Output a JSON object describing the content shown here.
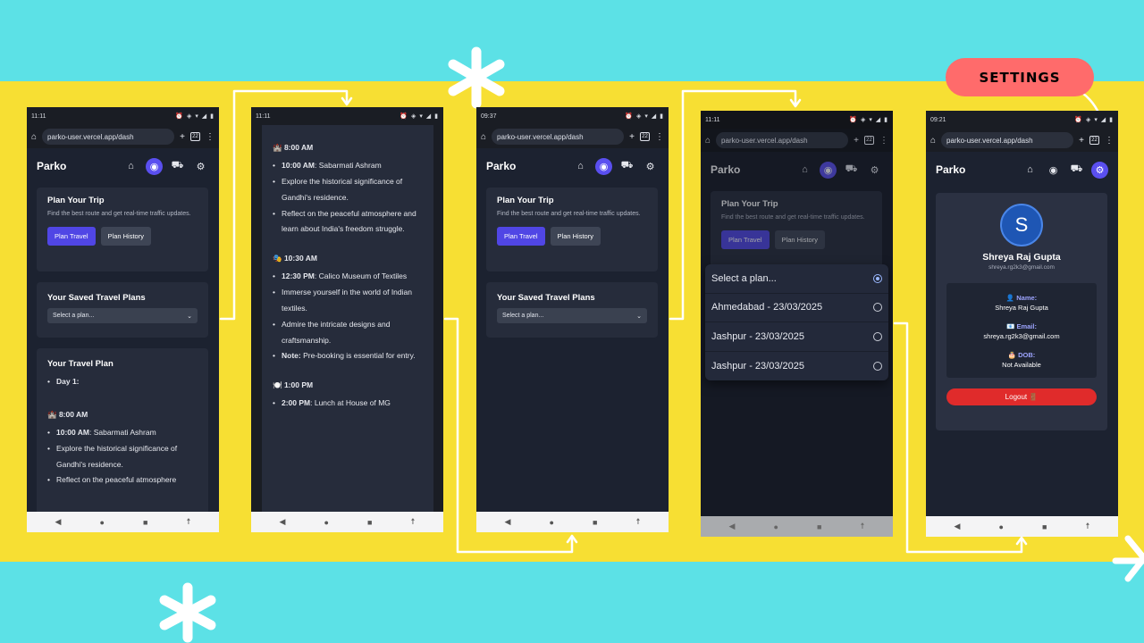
{
  "callout": {
    "label": "SETTINGS"
  },
  "app": {
    "brand": "Parko",
    "url": "parko-user.vercel.app/dash",
    "tab_count": "22"
  },
  "phone1": {
    "time": "11:11",
    "plan_card": {
      "title": "Plan Your Trip",
      "desc": "Find the best route and get real-time traffic updates.",
      "btn_travel": "Plan Travel",
      "btn_history": "Plan History"
    },
    "saved": {
      "title": "Your Saved Travel Plans",
      "select": "Select a plan..."
    },
    "travel": {
      "title": "Your Travel Plan",
      "day": "Day 1:",
      "t1": "🏰 8:00 AM",
      "i1_time": "10:00 AM",
      "i1_text": ": Sabarmati Ashram",
      "i2": "Explore the historical significance of Gandhi's residence.",
      "i3": "Reflect on the peaceful atmosphere"
    }
  },
  "phone2": {
    "time": "11:11",
    "t1": "🏰 8:00 AM",
    "a1_time": "10:00 AM",
    "a1_text": ": Sabarmati Ashram",
    "a2": "Explore the historical significance of Gandhi's residence.",
    "a3": "Reflect on the peaceful atmosphere and learn about India's freedom struggle.",
    "t2": "🎭 10:30 AM",
    "b1_time": "12:30 PM",
    "b1_text": ": Calico Museum of Textiles",
    "b2": "Immerse yourself in the world of Indian textiles.",
    "b3": "Admire the intricate designs and craftsmanship.",
    "b4_bold": "Note:",
    "b4_text": " Pre-booking is essential for entry.",
    "t3": "🍽️ 1:00 PM",
    "c1_time": "2:00 PM",
    "c1_text": ": Lunch at House of MG"
  },
  "phone3": {
    "time": "09:37",
    "plan_card": {
      "title": "Plan Your Trip",
      "desc": "Find the best route and get real-time traffic updates.",
      "btn_travel": "Plan Travel",
      "btn_history": "Plan History"
    },
    "saved": {
      "title": "Your Saved Travel Plans",
      "select": "Select a plan..."
    }
  },
  "phone4": {
    "time": "11:11",
    "plan_card": {
      "title": "Plan Your Trip",
      "desc": "Find the best route and get real-time traffic updates.",
      "btn_travel": "Plan Travel",
      "btn_history": "Plan History"
    },
    "options": [
      "Select a plan...",
      "Ahmedabad - 23/03/2025",
      "Jashpur - 23/03/2025",
      "Jashpur - 23/03/2025"
    ]
  },
  "phone5": {
    "time": "09:21",
    "avatar_letter": "S",
    "name": "Shreya Raj Gupta",
    "email_small": "shreya.rg2k3@gmail.com",
    "name_label": "👤 Name:",
    "name_value": "Shreya Raj Gupta",
    "email_label": "📧 Email:",
    "email_value": "shreya.rg2k3@gmail.com",
    "dob_label": "🎂 DOB:",
    "dob_value": "Not Available",
    "logout": "Logout 🚪"
  }
}
